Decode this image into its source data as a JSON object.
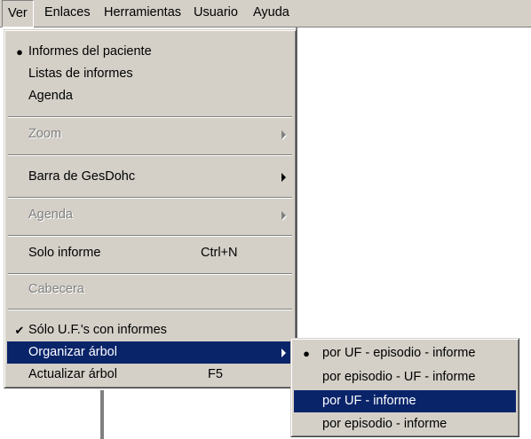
{
  "menubar": {
    "items": [
      {
        "label": "Ver"
      },
      {
        "label": "Enlaces"
      },
      {
        "label": "Herramientas"
      },
      {
        "label": "Usuario"
      },
      {
        "label": "Ayuda"
      }
    ]
  },
  "ver_menu": {
    "items": [
      {
        "label": "Informes del paciente",
        "mark": "●",
        "state": "enabled"
      },
      {
        "label": "Listas de informes",
        "state": "enabled"
      },
      {
        "label": "Agenda",
        "state": "enabled"
      },
      {
        "label": "Zoom",
        "state": "disabled",
        "submenu": true
      },
      {
        "label": "Barra de GesDohc",
        "state": "enabled",
        "submenu": true
      },
      {
        "label": "Agenda",
        "state": "disabled",
        "submenu": true
      },
      {
        "label": "Solo informe",
        "shortcut": "Ctrl+N",
        "state": "enabled"
      },
      {
        "label": "Cabecera",
        "state": "disabled"
      },
      {
        "label": "Sólo U.F.'s con informes",
        "mark": "✔",
        "state": "enabled"
      },
      {
        "label": "Organizar árbol",
        "state": "highlighted",
        "submenu": true
      },
      {
        "label": "Actualizar árbol",
        "shortcut": "F5",
        "state": "enabled"
      }
    ]
  },
  "organizar_submenu": {
    "items": [
      {
        "label": "por UF - episodio - informe",
        "mark": "●",
        "state": "enabled"
      },
      {
        "label": "por episodio - UF  - informe",
        "state": "enabled"
      },
      {
        "label": "por UF - informe",
        "state": "highlighted"
      },
      {
        "label": "por episodio - informe",
        "state": "enabled"
      }
    ]
  },
  "colors": {
    "menu_face": "#d4d0c8",
    "highlight": "#0a246a",
    "disabled_text": "#808080"
  }
}
